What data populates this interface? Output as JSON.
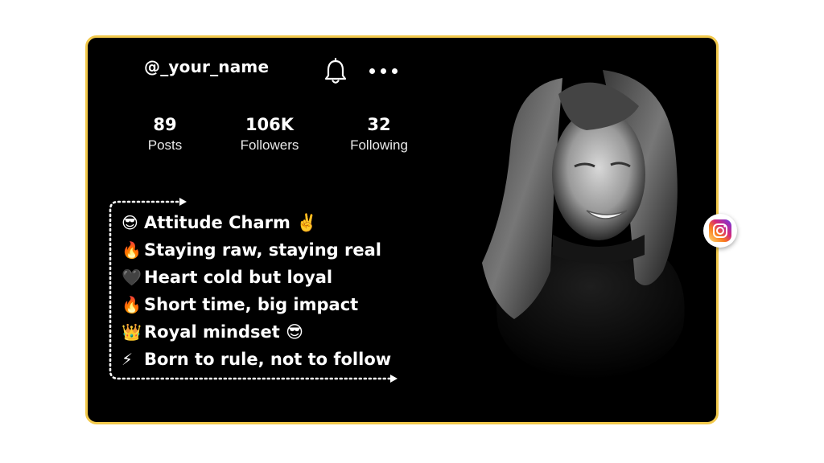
{
  "profile": {
    "username": "@_your_name",
    "stats": [
      {
        "value": "89",
        "label": "Posts"
      },
      {
        "value": "106K",
        "label": "Followers"
      },
      {
        "value": "32",
        "label": "Following"
      }
    ],
    "bio": [
      {
        "emoji": "😎",
        "text": "Attitude Charm ✌️"
      },
      {
        "emoji": "🔥",
        "text": "Staying raw, staying real"
      },
      {
        "emoji": "🖤",
        "text": "Heart cold but loyal"
      },
      {
        "emoji": "🔥",
        "text": "Short time, big impact"
      },
      {
        "emoji": "👑",
        "text": "Royal mindset 😎"
      },
      {
        "emoji": "⚡",
        "text": "Born to rule, not to follow"
      }
    ]
  },
  "icons": {
    "bell": "bell-icon",
    "more": "more-dots-icon",
    "instagram": "instagram-icon"
  },
  "colors": {
    "card_bg": "#000000",
    "card_border": "#f2c94c",
    "text": "#ffffff"
  }
}
